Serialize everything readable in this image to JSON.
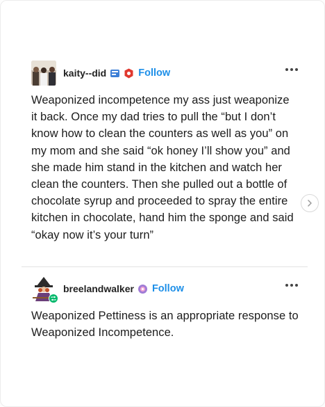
{
  "posts": [
    {
      "username": "kaity--did",
      "follow_label": "Follow",
      "avatar_icon": "photo-avatar",
      "badges": [
        "blue-badge-icon",
        "red-badge-icon"
      ],
      "text": "Weaponized incompetence my ass just weaponize it back. Once my dad tries to pull the “but I don’t know how to clean the counters as well as you” on my mom and she said “ok honey I’ll show you” and she made him stand in the kitchen and watch her clean the counters. Then she pulled out a bottle of chocolate syrup and proceeded to spray the entire kitchen in chocolate, hand him the sponge and said “okay now it’s your turn”"
    },
    {
      "username": "breelandwalker",
      "follow_label": "Follow",
      "avatar_icon": "witch-avatar",
      "badges": [
        "purple-badge-icon"
      ],
      "text": "Weaponized Pettiness is an appropriate response to Weaponized Incompetence."
    }
  ],
  "colors": {
    "follow": "#1d8fe8",
    "reblog": "#00b86b"
  }
}
